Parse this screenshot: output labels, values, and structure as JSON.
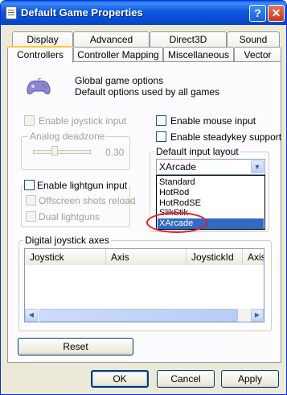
{
  "window": {
    "title": "Default Game Properties",
    "help_button": "?",
    "close_button": "✕"
  },
  "tabs_row_back": [
    "Display",
    "Advanced",
    "Direct3D",
    "Sound"
  ],
  "tabs_row_front": [
    "Controllers",
    "Controller Mapping",
    "Miscellaneous",
    "Vector"
  ],
  "header": {
    "line1": "Global game options",
    "line2": "Default options used by all games"
  },
  "joystick": {
    "enable_label": "Enable joystick input",
    "deadzone_title": "Analog deadzone",
    "deadzone_value": "0.30",
    "deadzone_level": 0.3
  },
  "mouse": {
    "label": "Enable mouse input"
  },
  "steadykey": {
    "label": "Enable steadykey support"
  },
  "input_layout": {
    "title": "Default input layout",
    "selected": "XArcade",
    "options": [
      "Standard",
      "HotRod",
      "HotRodSE",
      "SlikStik",
      "XArcade"
    ]
  },
  "lightgun": {
    "enable_label": "Enable lightgun input",
    "offscreen_label": "Offscreen shots reload",
    "dual_label": "Dual lightguns"
  },
  "axes": {
    "title": "Digital joystick axes",
    "columns": [
      "Joystick",
      "Axis",
      "JoystickId",
      "Axis"
    ]
  },
  "buttons": {
    "reset": "Reset",
    "ok": "OK",
    "cancel": "Cancel",
    "apply": "Apply"
  },
  "colors": {
    "title_bar": "#0a55dc",
    "selection": "#316ac5",
    "annotation": "#e0202a"
  }
}
